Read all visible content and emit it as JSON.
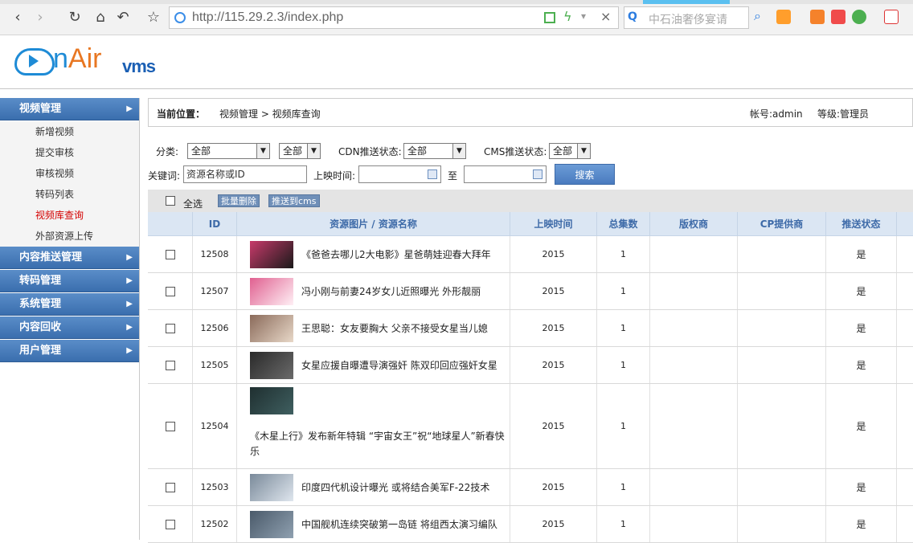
{
  "browser": {
    "url": "http://115.29.2.3/index.php",
    "search_placeholder": "中石油奢侈宴请"
  },
  "logo": {
    "brand_n": "n",
    "brand_air": "Air",
    "product": "vms"
  },
  "sidebar": {
    "sections": [
      {
        "label": "视频管理",
        "items": [
          "新增视频",
          "提交审核",
          "审核视频",
          "转码列表",
          "视频库查询",
          "外部资源上传"
        ],
        "active": "视频库查询"
      },
      {
        "label": "内容推送管理"
      },
      {
        "label": "转码管理"
      },
      {
        "label": "系统管理"
      },
      {
        "label": "内容回收"
      },
      {
        "label": "用户管理"
      }
    ]
  },
  "breadcrumb": {
    "label": "当前位置：",
    "path": "视频管理 > 视频库查询"
  },
  "account": {
    "user": "帐号:admin",
    "level": "等级:管理员"
  },
  "filters": {
    "category_label": "分类:",
    "category_value": "全部",
    "category2_value": "全部",
    "cdn_label": "CDN推送状态:",
    "cdn_value": "全部",
    "cms_label": "CMS推送状态:",
    "cms_value": "全部",
    "keyword_label": "关键词:",
    "keyword_value": "资源名称或ID",
    "date_label": "上映时间:",
    "to_label": "至",
    "search_button": "搜索"
  },
  "actions": {
    "select_all": "全选",
    "batch_delete": "批量删除",
    "push_cms": "推送到cms"
  },
  "table": {
    "headers": [
      "ID",
      "资源图片 / 资源名称",
      "上映时间",
      "总集数",
      "版权商",
      "CP提供商",
      "推送状态"
    ],
    "rows": [
      {
        "id": "12508",
        "title": "《爸爸去哪儿2大电影》星爸萌娃迎春大拜年",
        "year": "2015",
        "episodes": "1",
        "pushed": "是"
      },
      {
        "id": "12507",
        "title": "冯小刚与前妻24岁女儿近照曝光 外形靓丽",
        "year": "2015",
        "episodes": "1",
        "pushed": "是"
      },
      {
        "id": "12506",
        "title": "王思聪：女友要胸大 父亲不接受女星当儿媳",
        "year": "2015",
        "episodes": "1",
        "pushed": "是"
      },
      {
        "id": "12505",
        "title": "女星应援自曝遭导演强奸 陈双印回应强奸女星",
        "year": "2015",
        "episodes": "1",
        "pushed": "是"
      },
      {
        "id": "12504",
        "title": "《木星上行》发布新年特辑 “宇宙女王”祝“地球星人”新春快乐",
        "year": "2015",
        "episodes": "1",
        "pushed": "是"
      },
      {
        "id": "12503",
        "title": "印度四代机设计曝光 或将结合美军F-22技术",
        "year": "2015",
        "episodes": "1",
        "pushed": "是"
      },
      {
        "id": "12502",
        "title": "中国舰机连续突破第一岛链 将组西太演习编队",
        "year": "2015",
        "episodes": "1",
        "pushed": "是"
      }
    ]
  },
  "colors": {
    "menu_head": "#4a7dbd",
    "active_item": "#d40000",
    "grid_head": "#dbe6f3"
  }
}
